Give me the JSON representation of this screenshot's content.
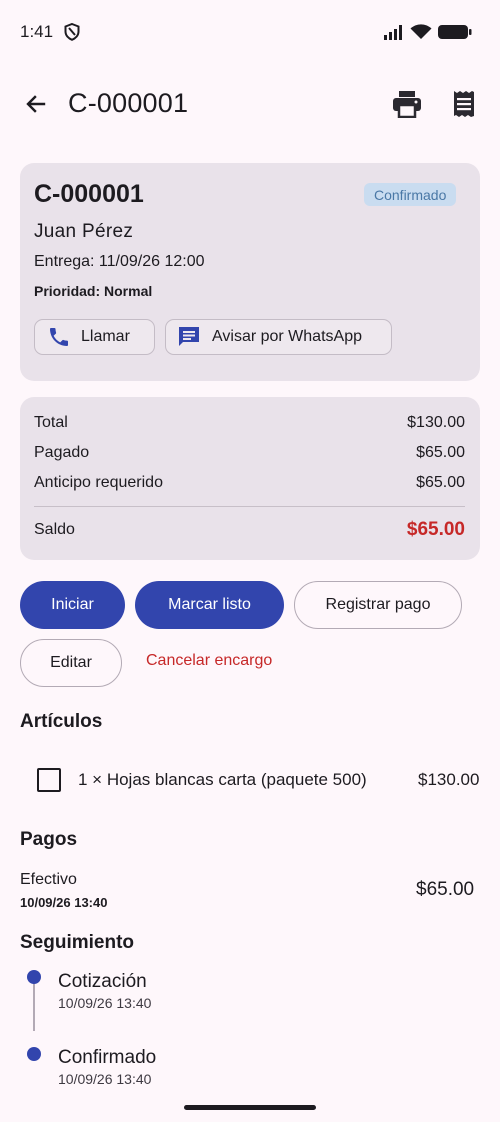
{
  "status_bar": {
    "time": "1:41"
  },
  "app_bar": {
    "title": "C-000001"
  },
  "order": {
    "id": "C-000001",
    "status": "Confirmado",
    "customer": "Juan Pérez",
    "delivery": "Entrega: 11/09/26 12:00",
    "priority": "Prioridad: Normal",
    "call_label": "Llamar",
    "whatsapp_label": "Avisar por WhatsApp"
  },
  "summary": {
    "total_label": "Total",
    "total_value": "$130.00",
    "paid_label": "Pagado",
    "paid_value": "$65.00",
    "deposit_label": "Anticipo requerido",
    "deposit_value": "$65.00",
    "balance_label": "Saldo",
    "balance_value": "$65.00"
  },
  "actions": {
    "start": "Iniciar",
    "mark_ready": "Marcar listo",
    "register_payment": "Registrar pago",
    "edit": "Editar",
    "cancel_order": "Cancelar encargo"
  },
  "items_section": {
    "title": "Artículos",
    "items": [
      {
        "description": "1 × Hojas blancas carta (paquete 500)",
        "price": "$130.00"
      }
    ]
  },
  "payments_section": {
    "title": "Pagos",
    "payments": [
      {
        "method": "Efectivo",
        "date": "10/09/26 13:40",
        "amount": "$65.00"
      }
    ]
  },
  "tracking_section": {
    "title": "Seguimiento",
    "events": [
      {
        "label": "Cotización",
        "date": "10/09/26 13:40"
      },
      {
        "label": "Confirmado",
        "date": "10/09/26 13:40"
      }
    ]
  },
  "colors": {
    "primary": "#3245ad",
    "danger": "#c62828",
    "card_bg": "#e9e2ea",
    "badge_bg": "#c9dcf0",
    "page_bg": "#fef7fb"
  },
  "icons": [
    "shield-icon",
    "signal-icon",
    "wifi-icon",
    "battery-icon",
    "back-arrow-icon",
    "print-icon",
    "receipt-icon",
    "phone-icon",
    "chat-icon",
    "checkbox-icon"
  ]
}
